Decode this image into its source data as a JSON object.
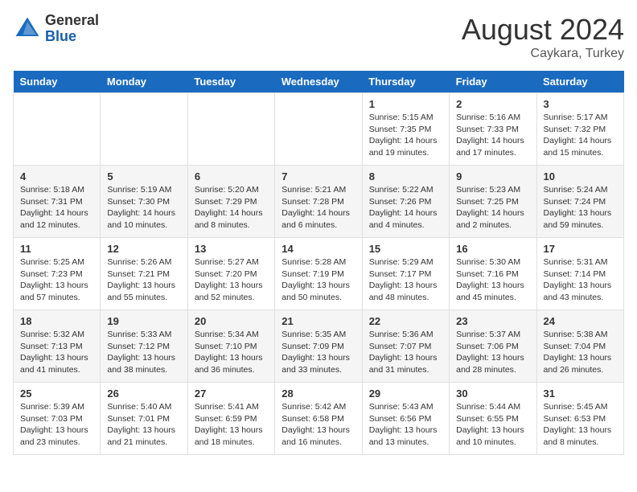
{
  "header": {
    "logo_general": "General",
    "logo_blue": "Blue",
    "month_year": "August 2024",
    "location": "Caykara, Turkey"
  },
  "days_of_week": [
    "Sunday",
    "Monday",
    "Tuesday",
    "Wednesday",
    "Thursday",
    "Friday",
    "Saturday"
  ],
  "weeks": [
    [
      {
        "day": "",
        "info": ""
      },
      {
        "day": "",
        "info": ""
      },
      {
        "day": "",
        "info": ""
      },
      {
        "day": "",
        "info": ""
      },
      {
        "day": "1",
        "info": "Sunrise: 5:15 AM\nSunset: 7:35 PM\nDaylight: 14 hours\nand 19 minutes."
      },
      {
        "day": "2",
        "info": "Sunrise: 5:16 AM\nSunset: 7:33 PM\nDaylight: 14 hours\nand 17 minutes."
      },
      {
        "day": "3",
        "info": "Sunrise: 5:17 AM\nSunset: 7:32 PM\nDaylight: 14 hours\nand 15 minutes."
      }
    ],
    [
      {
        "day": "4",
        "info": "Sunrise: 5:18 AM\nSunset: 7:31 PM\nDaylight: 14 hours\nand 12 minutes."
      },
      {
        "day": "5",
        "info": "Sunrise: 5:19 AM\nSunset: 7:30 PM\nDaylight: 14 hours\nand 10 minutes."
      },
      {
        "day": "6",
        "info": "Sunrise: 5:20 AM\nSunset: 7:29 PM\nDaylight: 14 hours\nand 8 minutes."
      },
      {
        "day": "7",
        "info": "Sunrise: 5:21 AM\nSunset: 7:28 PM\nDaylight: 14 hours\nand 6 minutes."
      },
      {
        "day": "8",
        "info": "Sunrise: 5:22 AM\nSunset: 7:26 PM\nDaylight: 14 hours\nand 4 minutes."
      },
      {
        "day": "9",
        "info": "Sunrise: 5:23 AM\nSunset: 7:25 PM\nDaylight: 14 hours\nand 2 minutes."
      },
      {
        "day": "10",
        "info": "Sunrise: 5:24 AM\nSunset: 7:24 PM\nDaylight: 13 hours\nand 59 minutes."
      }
    ],
    [
      {
        "day": "11",
        "info": "Sunrise: 5:25 AM\nSunset: 7:23 PM\nDaylight: 13 hours\nand 57 minutes."
      },
      {
        "day": "12",
        "info": "Sunrise: 5:26 AM\nSunset: 7:21 PM\nDaylight: 13 hours\nand 55 minutes."
      },
      {
        "day": "13",
        "info": "Sunrise: 5:27 AM\nSunset: 7:20 PM\nDaylight: 13 hours\nand 52 minutes."
      },
      {
        "day": "14",
        "info": "Sunrise: 5:28 AM\nSunset: 7:19 PM\nDaylight: 13 hours\nand 50 minutes."
      },
      {
        "day": "15",
        "info": "Sunrise: 5:29 AM\nSunset: 7:17 PM\nDaylight: 13 hours\nand 48 minutes."
      },
      {
        "day": "16",
        "info": "Sunrise: 5:30 AM\nSunset: 7:16 PM\nDaylight: 13 hours\nand 45 minutes."
      },
      {
        "day": "17",
        "info": "Sunrise: 5:31 AM\nSunset: 7:14 PM\nDaylight: 13 hours\nand 43 minutes."
      }
    ],
    [
      {
        "day": "18",
        "info": "Sunrise: 5:32 AM\nSunset: 7:13 PM\nDaylight: 13 hours\nand 41 minutes."
      },
      {
        "day": "19",
        "info": "Sunrise: 5:33 AM\nSunset: 7:12 PM\nDaylight: 13 hours\nand 38 minutes."
      },
      {
        "day": "20",
        "info": "Sunrise: 5:34 AM\nSunset: 7:10 PM\nDaylight: 13 hours\nand 36 minutes."
      },
      {
        "day": "21",
        "info": "Sunrise: 5:35 AM\nSunset: 7:09 PM\nDaylight: 13 hours\nand 33 minutes."
      },
      {
        "day": "22",
        "info": "Sunrise: 5:36 AM\nSunset: 7:07 PM\nDaylight: 13 hours\nand 31 minutes."
      },
      {
        "day": "23",
        "info": "Sunrise: 5:37 AM\nSunset: 7:06 PM\nDaylight: 13 hours\nand 28 minutes."
      },
      {
        "day": "24",
        "info": "Sunrise: 5:38 AM\nSunset: 7:04 PM\nDaylight: 13 hours\nand 26 minutes."
      }
    ],
    [
      {
        "day": "25",
        "info": "Sunrise: 5:39 AM\nSunset: 7:03 PM\nDaylight: 13 hours\nand 23 minutes."
      },
      {
        "day": "26",
        "info": "Sunrise: 5:40 AM\nSunset: 7:01 PM\nDaylight: 13 hours\nand 21 minutes."
      },
      {
        "day": "27",
        "info": "Sunrise: 5:41 AM\nSunset: 6:59 PM\nDaylight: 13 hours\nand 18 minutes."
      },
      {
        "day": "28",
        "info": "Sunrise: 5:42 AM\nSunset: 6:58 PM\nDaylight: 13 hours\nand 16 minutes."
      },
      {
        "day": "29",
        "info": "Sunrise: 5:43 AM\nSunset: 6:56 PM\nDaylight: 13 hours\nand 13 minutes."
      },
      {
        "day": "30",
        "info": "Sunrise: 5:44 AM\nSunset: 6:55 PM\nDaylight: 13 hours\nand 10 minutes."
      },
      {
        "day": "31",
        "info": "Sunrise: 5:45 AM\nSunset: 6:53 PM\nDaylight: 13 hours\nand 8 minutes."
      }
    ]
  ]
}
